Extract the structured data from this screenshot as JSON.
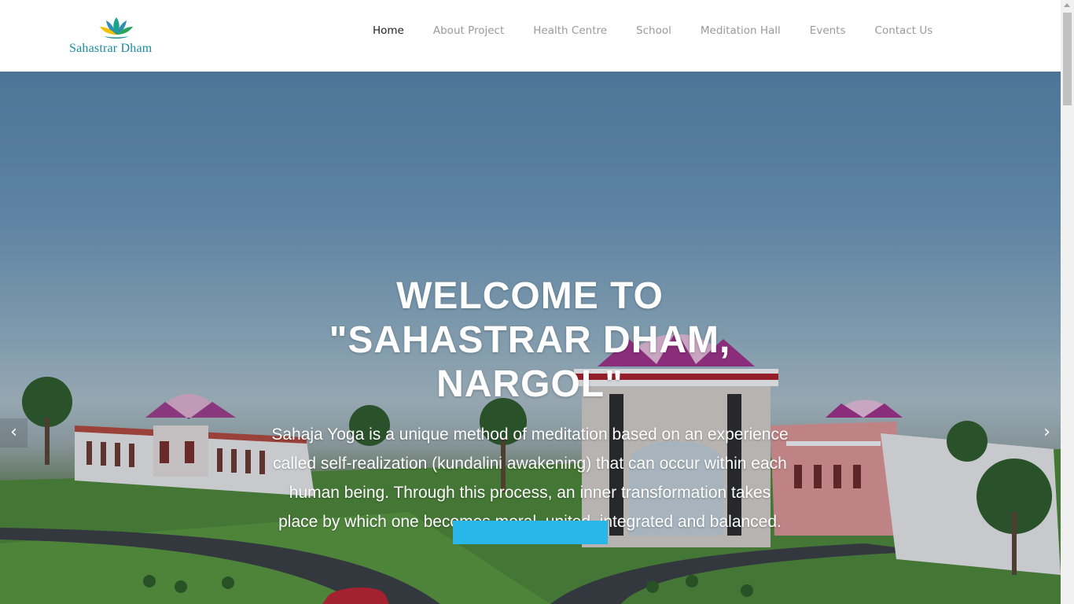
{
  "brand": {
    "name": "Sahastrar Dham",
    "logo_icon": "lotus-icon",
    "color": "#1b8ca0"
  },
  "nav": {
    "items": [
      {
        "label": "Home",
        "active": true
      },
      {
        "label": "About Project",
        "active": false
      },
      {
        "label": "Health Centre",
        "active": false
      },
      {
        "label": "School",
        "active": false
      },
      {
        "label": "Meditation Hall",
        "active": false
      },
      {
        "label": "Events",
        "active": false
      },
      {
        "label": "Contact Us",
        "active": false
      }
    ]
  },
  "hero": {
    "title_lines": [
      "WELCOME TO",
      "\"SAHASTRAR DHAM,",
      "NARGOL\""
    ],
    "text": "Sahaja Yoga is a unique method of meditation based on an experience called self-realization (kundalini awakening) that can occur within each human being. Through this process, an inner transformation takes place by which one becomes moral, united, integrated and balanced.",
    "button_color": "#29b6e8",
    "prev_icon": "chevron-left-icon",
    "next_icon": "chevron-right-icon",
    "prev_glyph": "‹",
    "next_glyph": "›"
  }
}
